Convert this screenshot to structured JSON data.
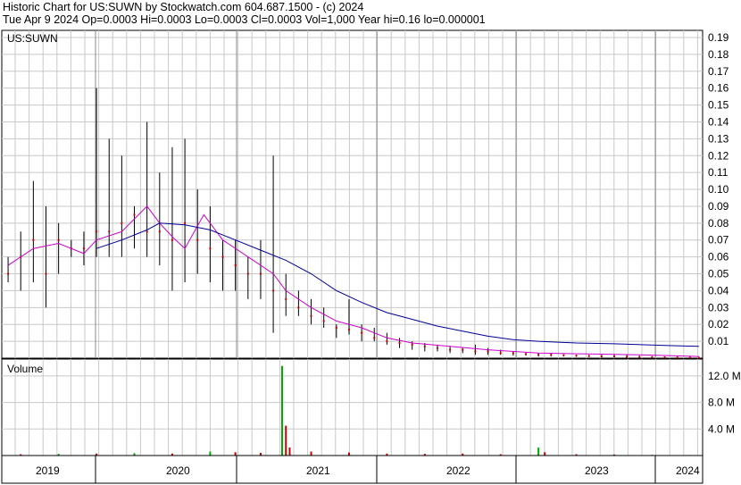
{
  "header": {
    "line1": "Historic Chart for US:SUWN by Stockwatch.com 604.687.1500 - (c) 2024",
    "line2": "Tue Apr  9 2024   Op=0.0003   Hi=0.0003   Lo=0.0003   Cl=0.0003   Vol=1,000   Year hi=0.16   lo=0.000001"
  },
  "colors": {
    "price_bar": "#000000",
    "close_dot": "#cc0000",
    "ma_short": "#cc00cc",
    "ma_long": "#000099",
    "grid": "#c8c8c8",
    "vol_up": "#00aa00",
    "vol_down": "#cc0000"
  },
  "chart_data": [
    {
      "type": "line",
      "label": "US:SUWN",
      "x_labels": [
        "2019",
        "2020",
        "2021",
        "2022",
        "2023",
        "2024"
      ],
      "y_ticks": [
        "0.19",
        "0.18",
        "0.17",
        "0.16",
        "0.15",
        "0.14",
        "0.13",
        "0.12",
        "0.11",
        "0.10",
        "0.09",
        "0.08",
        "0.07",
        "0.06",
        "0.05",
        "0.04",
        "0.03",
        "0.02",
        "0.01"
      ],
      "ylim": [
        0,
        0.19
      ],
      "grid": true,
      "series": [
        {
          "style": "price-bars",
          "x": [
            2018.8,
            2018.9,
            2019.0,
            2019.1,
            2019.2,
            2019.3,
            2019.4,
            2019.5,
            2019.6,
            2019.7,
            2019.8,
            2019.9,
            2020.0,
            2020.1,
            2020.2,
            2020.3,
            2020.4,
            2020.5,
            2020.6,
            2020.7,
            2020.8,
            2020.9,
            2021.0,
            2021.1,
            2021.2,
            2021.3,
            2021.4,
            2021.5,
            2021.6,
            2021.7,
            2021.8,
            2021.9,
            2022.0,
            2022.1,
            2022.2,
            2022.3,
            2022.4,
            2022.5,
            2022.6,
            2022.7,
            2022.8,
            2022.9,
            2023.0,
            2023.1,
            2023.2,
            2023.3,
            2023.4,
            2023.5,
            2023.6,
            2023.7,
            2023.8,
            2023.9,
            2024.0,
            2024.1,
            2024.2,
            2024.27
          ],
          "high": [
            0.06,
            0.075,
            0.105,
            0.09,
            0.08,
            0.07,
            0.075,
            0.16,
            0.13,
            0.12,
            0.09,
            0.14,
            0.11,
            0.125,
            0.13,
            0.1,
            0.09,
            0.07,
            0.07,
            0.06,
            0.07,
            0.12,
            0.05,
            0.04,
            0.035,
            0.03,
            0.02,
            0.035,
            0.02,
            0.018,
            0.015,
            0.012,
            0.01,
            0.009,
            0.008,
            0.007,
            0.006,
            0.008,
            0.006,
            0.005,
            0.004,
            0.003,
            0.003,
            0.003,
            0.002,
            0.002,
            0.002,
            0.002,
            0.002,
            0.002,
            0.0015,
            0.0012,
            0.001,
            0.001,
            0.0008,
            0.0003
          ],
          "low": [
            0.045,
            0.04,
            0.045,
            0.03,
            0.05,
            0.06,
            0.055,
            0.06,
            0.06,
            0.06,
            0.065,
            0.06,
            0.055,
            0.04,
            0.045,
            0.05,
            0.045,
            0.04,
            0.04,
            0.035,
            0.035,
            0.015,
            0.025,
            0.025,
            0.02,
            0.018,
            0.012,
            0.014,
            0.01,
            0.01,
            0.008,
            0.006,
            0.005,
            0.004,
            0.004,
            0.003,
            0.003,
            0.002,
            0.002,
            0.002,
            0.0015,
            0.0015,
            0.001,
            0.001,
            0.001,
            0.0008,
            0.0008,
            0.0006,
            0.0005,
            0.0005,
            0.0004,
            0.0004,
            0.0003,
            0.0003,
            0.0003,
            0.0003
          ],
          "close": [
            0.05,
            0.06,
            0.07,
            0.05,
            0.07,
            0.065,
            0.065,
            0.075,
            0.075,
            0.08,
            0.085,
            0.075,
            0.075,
            0.07,
            0.08,
            0.07,
            0.065,
            0.06,
            0.055,
            0.05,
            0.05,
            0.04,
            0.035,
            0.03,
            0.025,
            0.022,
            0.018,
            0.017,
            0.015,
            0.012,
            0.01,
            0.009,
            0.008,
            0.007,
            0.006,
            0.005,
            0.005,
            0.004,
            0.004,
            0.003,
            0.003,
            0.0025,
            0.002,
            0.002,
            0.0018,
            0.0015,
            0.0012,
            0.001,
            0.001,
            0.0008,
            0.0007,
            0.0006,
            0.0005,
            0.0004,
            0.0004,
            0.0003
          ]
        },
        {
          "style": "line",
          "color_key": "ma_short",
          "x": [
            2018.8,
            2019.0,
            2019.2,
            2019.4,
            2019.5,
            2019.7,
            2019.9,
            2020.0,
            2020.1,
            2020.2,
            2020.35,
            2020.5,
            2020.7,
            2020.9,
            2021.0,
            2021.2,
            2021.4,
            2021.6,
            2021.8,
            2022.0,
            2022.3,
            2022.6,
            2023.0,
            2023.4,
            2023.8,
            2024.27
          ],
          "y": [
            0.055,
            0.065,
            0.068,
            0.062,
            0.07,
            0.075,
            0.09,
            0.08,
            0.072,
            0.065,
            0.085,
            0.07,
            0.06,
            0.05,
            0.04,
            0.03,
            0.022,
            0.018,
            0.012,
            0.009,
            0.007,
            0.005,
            0.003,
            0.0025,
            0.002,
            0.001
          ]
        },
        {
          "style": "line",
          "color_key": "ma_long",
          "x": [
            2019.5,
            2019.7,
            2019.9,
            2020.0,
            2020.2,
            2020.4,
            2020.6,
            2020.8,
            2021.0,
            2021.2,
            2021.4,
            2021.6,
            2021.8,
            2022.0,
            2022.2,
            2022.4,
            2022.6,
            2022.8,
            2023.0,
            2023.3,
            2023.6,
            2024.0,
            2024.27
          ],
          "y": [
            0.065,
            0.07,
            0.076,
            0.08,
            0.079,
            0.076,
            0.07,
            0.064,
            0.058,
            0.05,
            0.04,
            0.033,
            0.027,
            0.023,
            0.019,
            0.016,
            0.013,
            0.011,
            0.01,
            0.009,
            0.0085,
            0.0075,
            0.007
          ]
        }
      ]
    },
    {
      "type": "bar",
      "label": "Volume",
      "y_ticks": [
        "12.0 M",
        "8.0 M",
        "4.0 M"
      ],
      "ylim": [
        0,
        14000000
      ],
      "grid": true,
      "x": [
        2018.9,
        2019.2,
        2019.5,
        2019.8,
        2020.1,
        2020.4,
        2020.6,
        2020.8,
        2020.97,
        2021.0,
        2021.03,
        2021.2,
        2021.5,
        2021.8,
        2022.1,
        2022.4,
        2022.7,
        2023.0,
        2023.05,
        2023.3,
        2023.6,
        2023.9,
        2024.2
      ],
      "values": [
        200000,
        250000,
        300000,
        350000,
        300000,
        600000,
        500000,
        400000,
        13500000,
        4500000,
        1200000,
        600000,
        450000,
        300000,
        250000,
        300000,
        200000,
        1200000,
        500000,
        200000,
        150000,
        100000,
        80000
      ],
      "up": [
        false,
        true,
        false,
        true,
        false,
        true,
        false,
        false,
        true,
        false,
        false,
        false,
        false,
        false,
        false,
        false,
        false,
        true,
        false,
        false,
        false,
        false,
        false
      ]
    }
  ]
}
